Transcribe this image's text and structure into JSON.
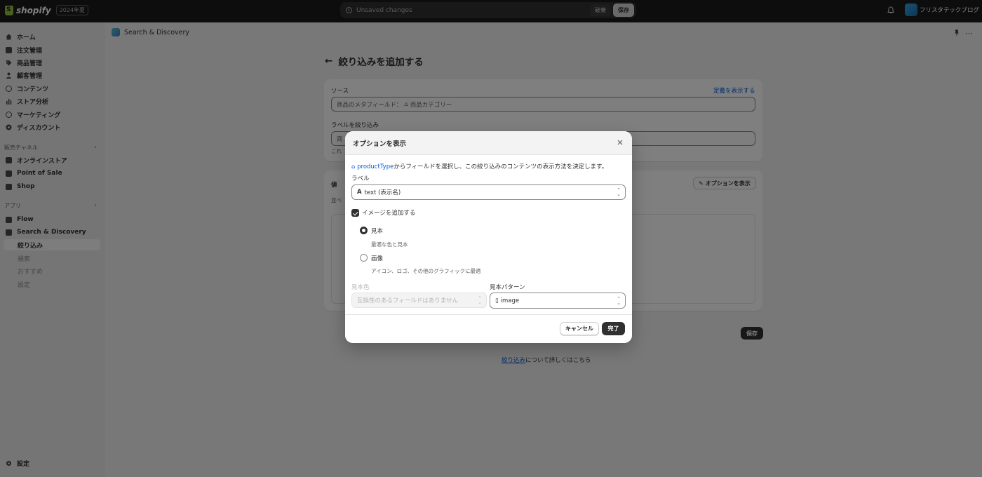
{
  "topbar": {
    "logo_text": "shopify",
    "logo_badge": "2024年夏",
    "unsaved_text": "Unsaved changes",
    "discard_label": "破棄",
    "save_label": "保存",
    "store_name": "フリスタテックブログ"
  },
  "sidebar": {
    "items": [
      {
        "label": "ホーム"
      },
      {
        "label": "注文管理"
      },
      {
        "label": "商品管理"
      },
      {
        "label": "顧客管理"
      },
      {
        "label": "コンテンツ"
      },
      {
        "label": "ストア分析"
      },
      {
        "label": "マーケティング"
      },
      {
        "label": "ディスカウント"
      }
    ],
    "sales_channels_heading": "販売チャネル",
    "channels": [
      {
        "label": "オンラインストア"
      },
      {
        "label": "Point of Sale"
      },
      {
        "label": "Shop"
      }
    ],
    "apps_heading": "アプリ",
    "apps": [
      {
        "label": "Flow"
      },
      {
        "label": "Search & Discovery"
      }
    ],
    "app_sub": [
      {
        "label": "絞り込み"
      },
      {
        "label": "検索"
      },
      {
        "label": "おすすめ"
      },
      {
        "label": "設定"
      }
    ],
    "settings_label": "設定"
  },
  "main": {
    "app_name": "Search & Discovery",
    "page_title": "絞り込みを追加する",
    "source_label": "ソース",
    "source_link": "定義を表示する",
    "source_prefix": "商品のメタフィールド：",
    "source_value": "商品カテゴリー",
    "filter_label_heading": "ラベルを絞り込み",
    "filter_label_partial": "商",
    "help_partial": "これ",
    "values_heading": "値",
    "values_sub_partial": "並べ",
    "options_button": "オプションを表示",
    "save_label": "保存",
    "learn_link": "絞り込み",
    "learn_rest": "について詳しくはこちら"
  },
  "modal": {
    "title": "オプションを表示",
    "intro_link": "productType",
    "intro_rest": "からフィールドを選択し、この絞り込みのコンテンツの表示方法を決定します。",
    "label_heading": "ラベル",
    "label_value": "text (表示名)",
    "add_image_label": "イメージを追加する",
    "option_swatch_label": "見本",
    "option_swatch_help": "最適な色と見本",
    "option_image_label": "画像",
    "option_image_help": "アイコン、ロゴ、その他のグラフィックに最適",
    "swatch_color_label": "見本色",
    "swatch_color_value": "互換性のあるフィールドはありません",
    "swatch_pattern_label": "見本パターン",
    "swatch_pattern_value": "image",
    "cancel_label": "キャンセル",
    "done_label": "完了"
  }
}
